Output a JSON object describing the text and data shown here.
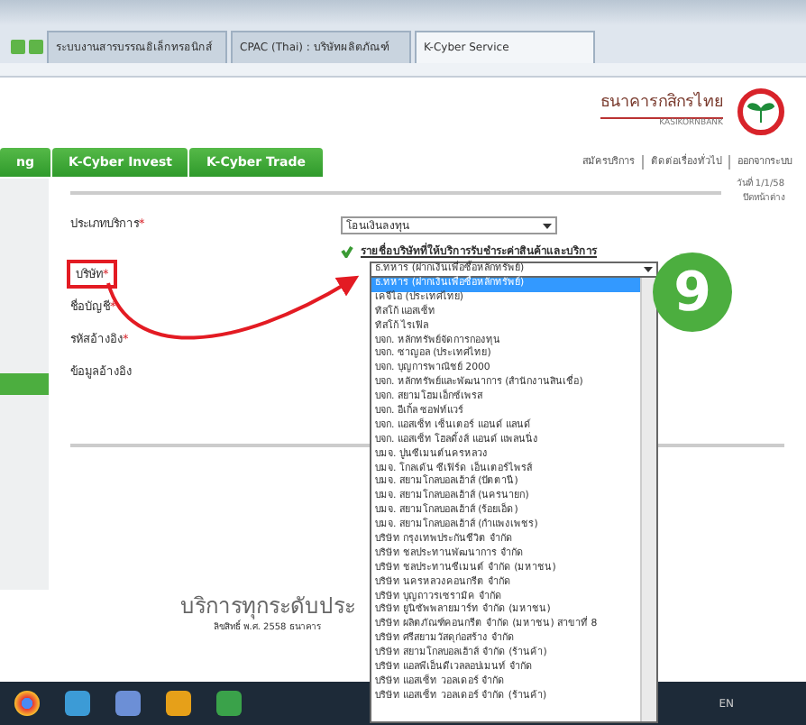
{
  "browser": {
    "tabs": [
      {
        "title": "ระบบงานสารบรรณอิเล็กทรอนิกส์",
        "selected": false
      },
      {
        "title": "CPAC (Thai) : บริษัทผลิตภัณฑ์",
        "selected": false
      },
      {
        "title": "K-Cyber Service",
        "selected": true
      }
    ]
  },
  "bank": {
    "name_th": "ธนาคารกสิกรไทย",
    "name_en": "KASIKORNBANK"
  },
  "nav_tabs": [
    {
      "label": "ng"
    },
    {
      "label": "K-Cyber Invest"
    },
    {
      "label": "K-Cyber Trade"
    }
  ],
  "top_links": [
    "สมัครบริการ",
    "ติดต่อเรื่องทั่วไป",
    "ออกจากระบบ"
  ],
  "side_note": [
    "วันที่ 1/1/58",
    "ปิดหน้าต่าง"
  ],
  "form": {
    "fields": [
      {
        "label": "ประเภทบริการ",
        "required_mark": "*",
        "highlighted": false,
        "value": "โอนเงินลงทุน"
      },
      {
        "label": "บริษัท",
        "required_mark": "*",
        "highlighted": true
      },
      {
        "label": "ชื่อบัญชี",
        "required_mark": "*",
        "highlighted": false
      },
      {
        "label": "รหัสอ้างอิง",
        "required_mark": "*",
        "highlighted": false
      },
      {
        "label": "ข้อมูลอ้างอิง",
        "highlighted": false
      }
    ],
    "notice": "รายชื่อบริษัทที่ให้บริการรับชำระค่าสินค้าและบริการ"
  },
  "dropdown": {
    "value": "ธ.ทหาร (ฝากเงินเพื่อซื้อหลักทรัพย์)",
    "options": [
      {
        "label": "ธ.ทหาร (ฝากเงินเพื่อซื้อหลักทรัพย์)",
        "selected": true
      },
      {
        "label": "เคจีไอ (ประเทศไทย)",
        "selected": false
      },
      {
        "label": "ทิสโก้ แอสเซ็ท",
        "selected": false
      },
      {
        "label": "ทิสโก้ ไรเฟิล",
        "selected": false
      },
      {
        "label": "บจก. หลักทรัพย์จัดการกองทุน",
        "selected": false
      },
      {
        "label": "บจก. ซาญอล (ประเทศไทย)",
        "selected": false
      },
      {
        "label": "บจก. บุญการพาณิชย์ 2000",
        "selected": false
      },
      {
        "label": "บจก. หลักทรัพย์และพัฒนาการ (สำนักงานสินเชื่อ)",
        "selected": false
      },
      {
        "label": "บจก. สยามโฮมเอ็กซ์เพรส",
        "selected": false
      },
      {
        "label": "บจก. อีเกิ้ล ซอฟท์แวร์",
        "selected": false
      },
      {
        "label": "บจก. แอสเซ็ท เซ็นเตอร์ แอนด์ แลนด์",
        "selected": false
      },
      {
        "label": "บจก. แอสเซ็ท โฮลดิ้งส์ แอนด์ แพลนนิ่ง",
        "selected": false
      },
      {
        "label": "บมจ. ปูนซีเมนต์นครหลวง",
        "selected": false
      },
      {
        "label": "บมจ. โกลเด้น ซีเฟิร์ด เอ็นเตอร์ไพรส์",
        "selected": false
      },
      {
        "label": "บมจ. สยามโกลบอลเฮ้าส์ (ปัตตานี)",
        "selected": false
      },
      {
        "label": "บมจ. สยามโกลบอลเฮ้าส์ (นครนายก)",
        "selected": false
      },
      {
        "label": "บมจ. สยามโกลบอลเฮ้าส์ (ร้อยเอ็ด)",
        "selected": false
      },
      {
        "label": "บมจ. สยามโกลบอลเฮ้าส์ (กำแพงเพชร)",
        "selected": false
      },
      {
        "label": "บริษัท กรุงเทพประกันชีวิต จำกัด",
        "selected": false
      },
      {
        "label": "บริษัท ชลประทานพัฒนาการ จำกัด",
        "selected": false
      },
      {
        "label": "บริษัท ชลประทานซีเมนต์ จำกัด (มหาชน)",
        "selected": false
      },
      {
        "label": "บริษัท นครหลวงคอนกรีต จำกัด",
        "selected": false
      },
      {
        "label": "บริษัท บุญถาวรเซรามิค จำกัด",
        "selected": false
      },
      {
        "label": "บริษัท ยูนิซัพพลายมาร์ท จำกัด (มหาชน)",
        "selected": false
      },
      {
        "label": "บริษัท ผลิตภัณฑ์คอนกรีต จำกัด (มหาชน) สาขาที่ 8",
        "selected": false
      },
      {
        "label": "บริษัท ศรีสยามวัสดุก่อสร้าง จำกัด",
        "selected": false
      },
      {
        "label": "บริษัท สยามโกลบอลเฮ้าส์ จำกัด (ร้านค้า)",
        "selected": false
      },
      {
        "label": "บริษัท แอลพีเอ็นดีเวลลอปเมนท์ จำกัด",
        "selected": false
      },
      {
        "label": "บริษัท แอสเซ็ท วอลเดอร์ จำกัด",
        "selected": false
      },
      {
        "label": "บริษัท แอสเซ็ท วอลเดอร์ จำกัด (ร้านค้า)",
        "selected": false
      }
    ]
  },
  "step_badge": "9",
  "footer": {
    "slogan": "บริการทุกระดับประ",
    "copyright": "ลิขสิทธิ์ พ.ศ. 2558 ธนาคาร"
  },
  "taskbar": {
    "language": "EN"
  }
}
